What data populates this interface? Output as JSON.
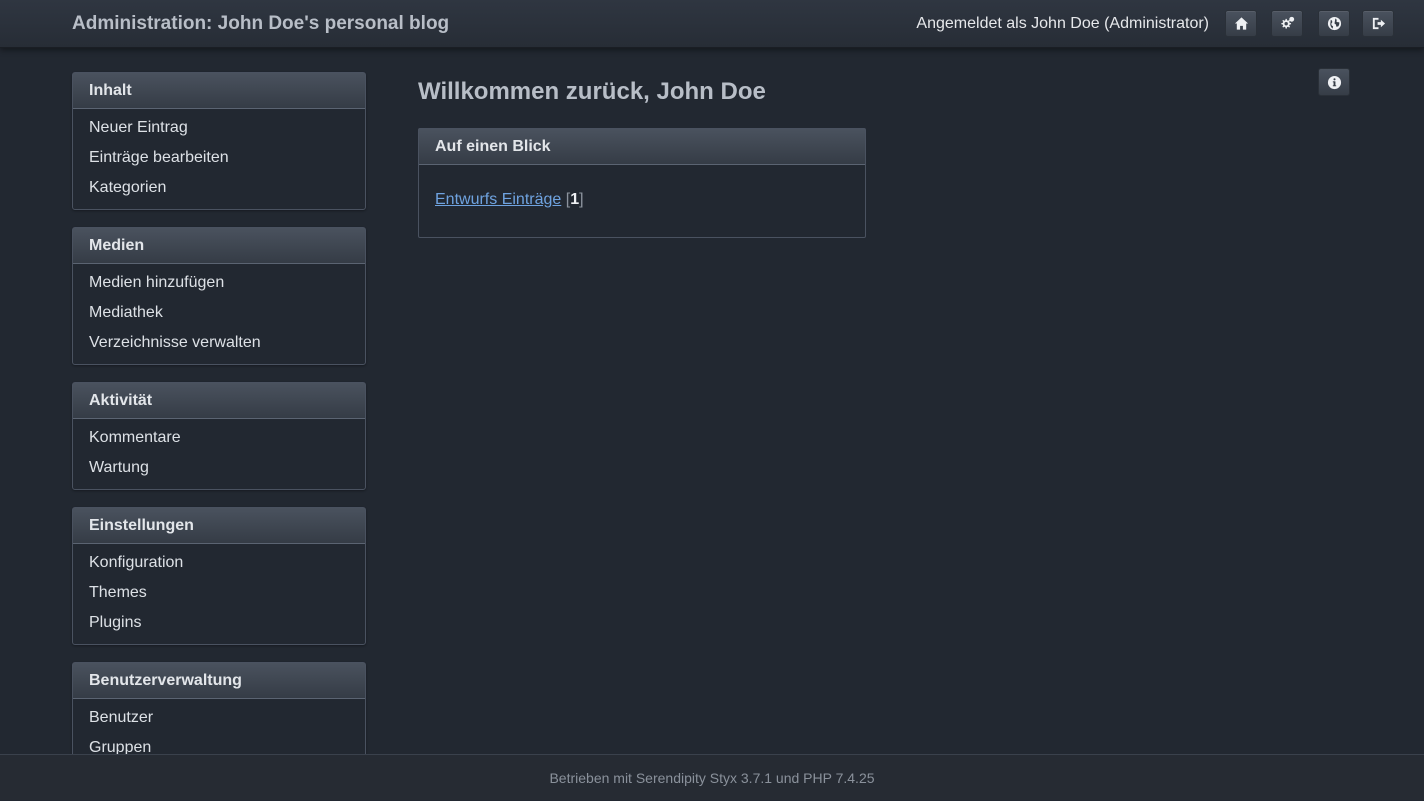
{
  "header": {
    "site_title": "Administration: John Doe's personal blog",
    "login_info": "Angemeldet als John Doe (Administrator)",
    "buttons": [
      "home-icon",
      "cogs-icon",
      "globe-icon",
      "sign-out-icon"
    ]
  },
  "sidebar": {
    "sections": [
      {
        "title": "Inhalt",
        "items": [
          "Neuer Eintrag",
          "Einträge bearbeiten",
          "Kategorien"
        ]
      },
      {
        "title": "Medien",
        "items": [
          "Medien hinzufügen",
          "Mediathek",
          "Verzeichnisse verwalten"
        ]
      },
      {
        "title": "Aktivität",
        "items": [
          "Kommentare",
          "Wartung"
        ]
      },
      {
        "title": "Einstellungen",
        "items": [
          "Konfiguration",
          "Themes",
          "Plugins"
        ]
      },
      {
        "title": "Benutzerverwaltung",
        "items": [
          "Benutzer",
          "Gruppen"
        ]
      }
    ]
  },
  "main": {
    "title": "Willkommen zurück, John Doe",
    "panel": {
      "title": "Auf einen Blick",
      "link_label": "Entwurfs Einträge",
      "bracket_open": "[",
      "count": "1",
      "bracket_close": "]"
    },
    "info_button": "info-icon"
  },
  "footer": {
    "text": "Betrieben mit Serendipity Styx 3.7.1 und PHP 7.4.25"
  },
  "colors": {
    "background": "#222831",
    "link": "#6fa3e0",
    "header_gradient_top": "#4a525e"
  }
}
